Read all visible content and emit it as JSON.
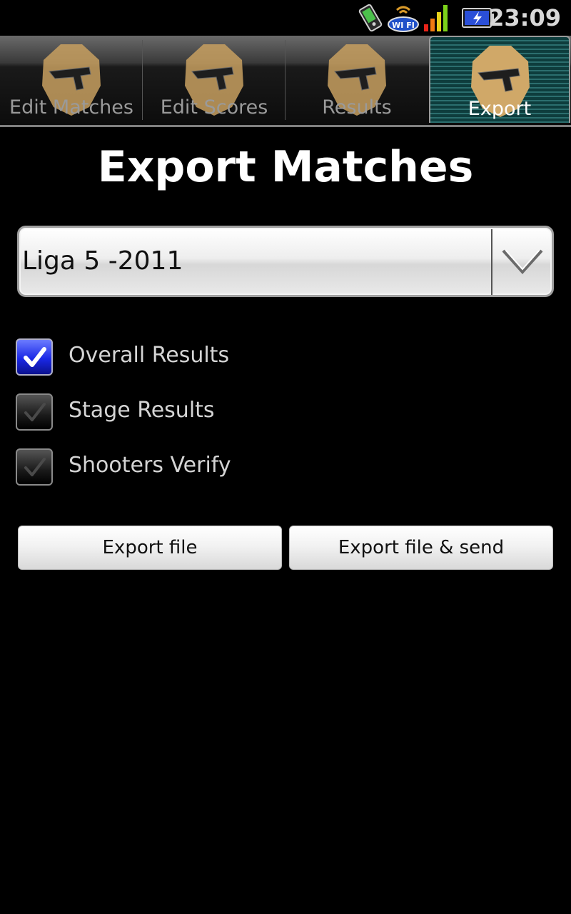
{
  "status_bar": {
    "time": "23:09",
    "wifi_label": "WI FI",
    "icons": [
      "usb-debug-icon",
      "wifi-icon",
      "signal-icon",
      "battery-charging-icon"
    ],
    "signal_colors": [
      "#e8241a",
      "#f07a12",
      "#e8d21a",
      "#7cd21a"
    ]
  },
  "tabs": [
    {
      "label": "Edit Matches",
      "icon": "target-pistol-icon",
      "active": false
    },
    {
      "label": "Edit Scores",
      "icon": "target-pistol-icon",
      "active": false
    },
    {
      "label": "Results",
      "icon": "target-pistol-icon",
      "active": false
    },
    {
      "label": "Export",
      "icon": "target-pistol-icon",
      "active": true
    }
  ],
  "page_title": "Export Matches",
  "match_select": {
    "selected": "Liga 5 -2011"
  },
  "options": [
    {
      "label": "Overall Results",
      "checked": true
    },
    {
      "label": "Stage Results",
      "checked": false
    },
    {
      "label": "Shooters Verify",
      "checked": false
    }
  ],
  "buttons": {
    "export_file": "Export file",
    "export_file_send": "Export file & send"
  },
  "colors": {
    "accent_active_tab": "#2b6e6e",
    "checkbox_checked": "#1a28e6",
    "target_gold": "#c8a060"
  }
}
